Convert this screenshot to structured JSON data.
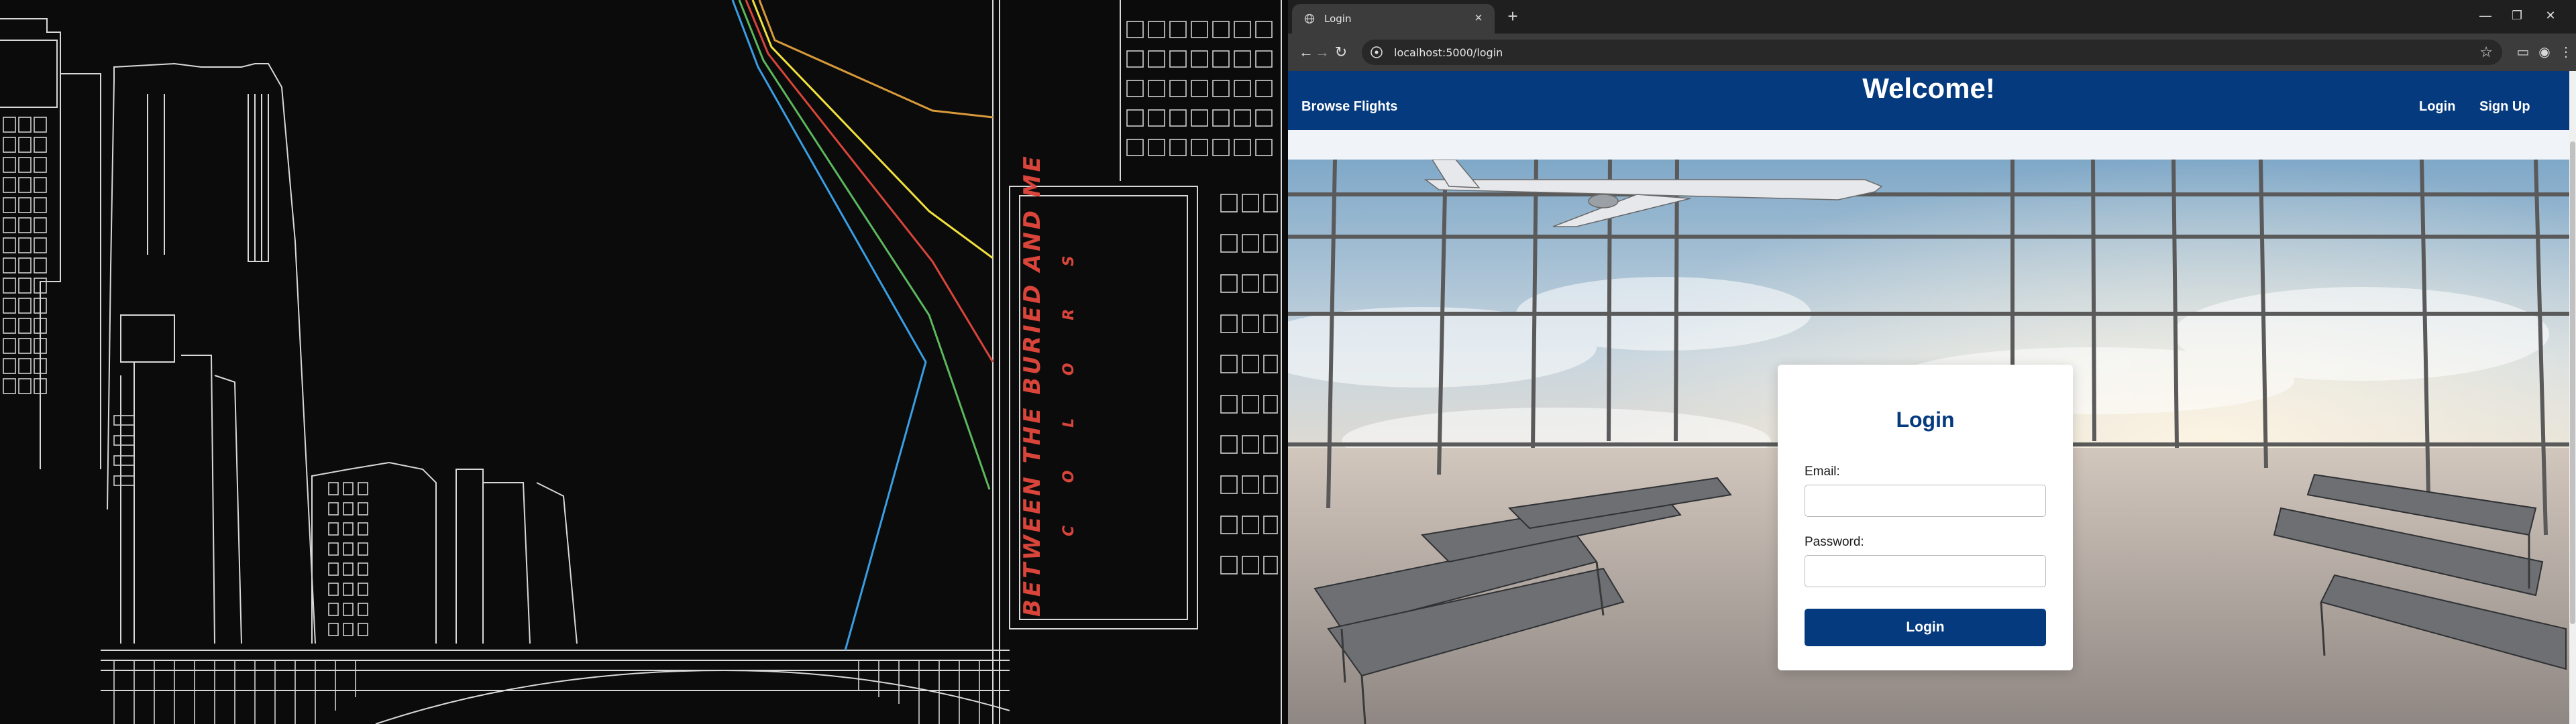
{
  "wallpaper": {
    "vertical_text_line1": "BETWEEN THE BURIED AND ME",
    "vertical_text_line2": "C O L O R S",
    "line_colors": [
      "#3a9ee4",
      "#5cb85c",
      "#d9453a",
      "#f2e23d",
      "#d99a3a"
    ]
  },
  "browser": {
    "tab": {
      "title": "Login",
      "favicon": "globe-icon"
    },
    "url": "localhost:5000/login",
    "window_controls": [
      "minimize-icon",
      "restore-icon",
      "close-icon"
    ]
  },
  "navbar": {
    "brand": "Browse Flights",
    "welcome": "Welcome!",
    "links": [
      "Login",
      "Sign Up"
    ],
    "background": "#053a7e"
  },
  "login": {
    "title": "Login",
    "email_label": "Email:",
    "email_value": "",
    "password_label": "Password:",
    "password_value": "",
    "submit": "Login",
    "accent": "#053a7e"
  }
}
